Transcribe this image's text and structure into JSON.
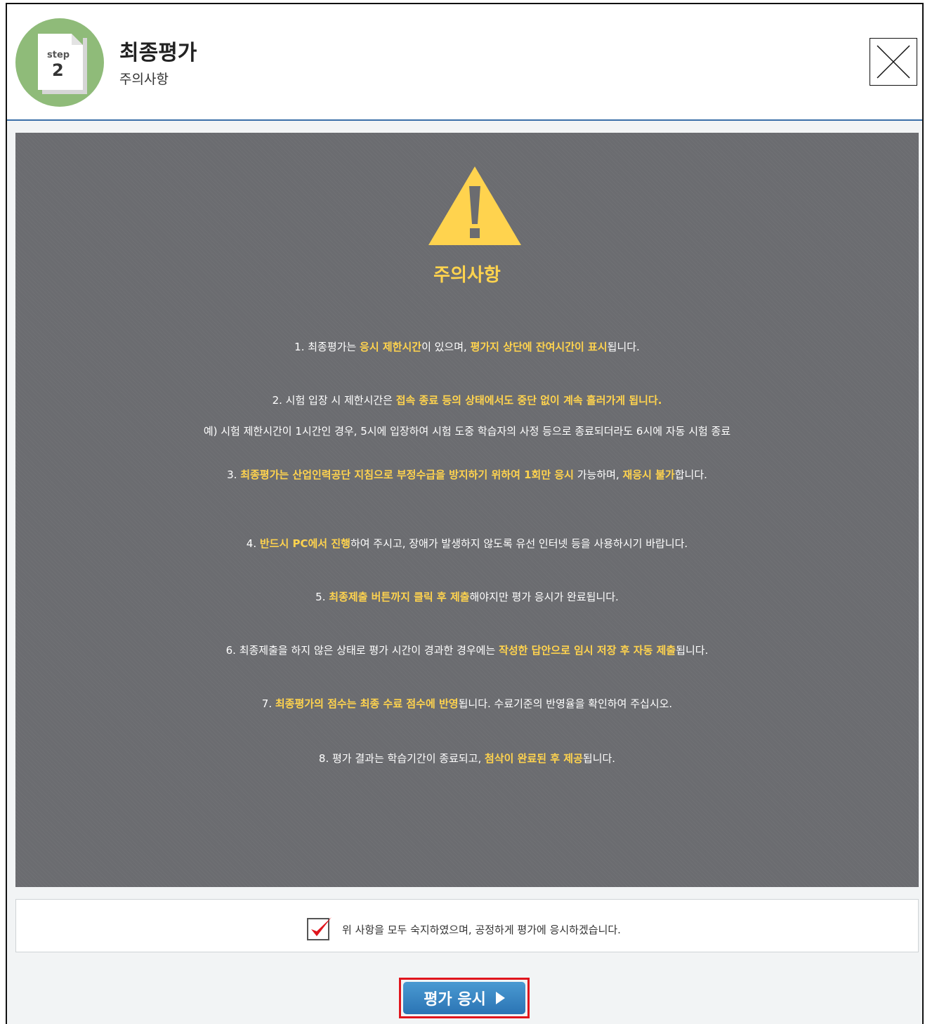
{
  "header": {
    "step_label": "step",
    "step_number": "2",
    "title": "최종평가",
    "subtitle": "주의사항"
  },
  "notice": {
    "title": "주의사항",
    "items": [
      [
        {
          "t": "1. 최종평가는 "
        },
        {
          "t": "응시 제한시간",
          "hl": true
        },
        {
          "t": "이 있으며, "
        },
        {
          "t": "평가지 상단에 잔여시간이 표시",
          "hl": true
        },
        {
          "t": "됩니다."
        }
      ],
      [
        {
          "t": "2. 시험 입장 시 제한시간은 "
        },
        {
          "t": "접속 종료 등의 상태에서도 중단 없이 계속 흘러가게 됩니다.",
          "hl": true
        }
      ],
      [
        {
          "t": "예) 시험 제한시간이 1시간인 경우, 5시에 입장하여 시험 도중 학습자의 사정 등으로 종료되더라도 6시에 자동 시험 종료"
        }
      ],
      [
        {
          "t": "3. "
        },
        {
          "t": "최종평가는 산업인력공단 지침으로 부정수급을 방지하기 위하여 1회만 응시",
          "hl": true
        },
        {
          "t": " 가능하며, "
        },
        {
          "t": "재응시 불가",
          "hl": true
        },
        {
          "t": "합니다."
        }
      ],
      [
        {
          "t": "4. "
        },
        {
          "t": "반드시 PC에서 진행",
          "hl": true
        },
        {
          "t": "하여 주시고, 장애가 발생하지 않도록 유선 인터넷 등을 사용하시기 바랍니다."
        }
      ],
      [
        {
          "t": "5. "
        },
        {
          "t": "최종제출 버튼까지 클릭 후 제출",
          "hl": true
        },
        {
          "t": "해야지만 평가 응시가 완료됩니다."
        }
      ],
      [
        {
          "t": "6. 최종제출을 하지 않은 상태로 평가 시간이 경과한 경우에는 "
        },
        {
          "t": "작성한 답안으로 임시 저장 후 자동 제출",
          "hl": true
        },
        {
          "t": "됩니다."
        }
      ],
      [
        {
          "t": "7. "
        },
        {
          "t": "최종평가의 점수는 최종 수료 점수에 반영",
          "hl": true
        },
        {
          "t": "됩니다. 수료기준의 반영율을 확인하여 주십시오."
        }
      ],
      [
        {
          "t": "8. 평가 결과는 학습기간이 종료되고, "
        },
        {
          "t": "첨삭이 완료된 후 제공",
          "hl": true
        },
        {
          "t": "됩니다."
        }
      ]
    ]
  },
  "agreement": {
    "checked": true,
    "text": "위 사항을 모두 숙지하였으며, 공정하게 평가에 응시하겠습니다."
  },
  "start_button": {
    "label": "평가 응시"
  },
  "colors": {
    "highlight": "#ffd34e",
    "panel_bg": "#6b6c70",
    "badge_green": "#8fbb79",
    "button_blue": "#2b74b4",
    "focus_red": "#e0151d"
  }
}
